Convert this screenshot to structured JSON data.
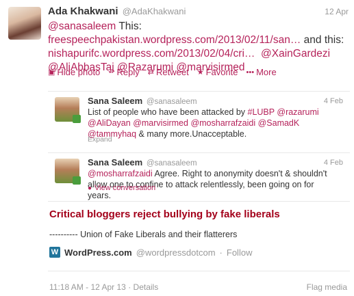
{
  "tweet": {
    "author_name": "Ada Khakwani",
    "author_handle": "@AdaKhakwani",
    "date": "12 Apr",
    "mention_lead": "@sanasaleem",
    "text_this": " This:",
    "link1": "freespeechpakistan.wordpress.com/2013/02/11/san…",
    "text_and": " and this:",
    "link2": "nishapurifc.wordpress.com/2013/02/04/cri…",
    "mention2": "@XainGardezi",
    "mention3": "@AliAbbasTaj",
    "mention4": "@Razarumi",
    "mention5": "@marvisirmed"
  },
  "actions": {
    "hide_photo": "Hide photo",
    "reply": "Reply",
    "retweet": "Retweet",
    "favorite": "Favorite",
    "more": "More"
  },
  "quote1": {
    "name": "Sana Saleem",
    "handle": "@sanasaleem",
    "date": "4 Feb",
    "text_pre": "List of people who have been attacked by ",
    "hashtag": "#LUBP",
    "m1": "@razarumi",
    "m2": "@AliDayan",
    "m3": "@marvisirmed",
    "m4": "@mosharrafzaidi",
    "m5": "@SamadK",
    "m6": "@tammyhaq",
    "text_post": " & many more.Unacceptable.",
    "expand": "Expand"
  },
  "quote2": {
    "name": "Sana Saleem",
    "handle": "@sanasaleem",
    "date": "4 Feb",
    "mention": "@mosharrafzaidi",
    "text": " Agree. Right to anonymity doesn't & shouldn't allow one to confine to attack relentlessly, been going on for years.",
    "view_conversation": "View conversation"
  },
  "card": {
    "headline": "Critical bloggers reject bullying by fake liberals",
    "subline": "---------- Union of Fake Liberals and their flatterers",
    "site_name": "WordPress.com",
    "site_handle": "@wordpressdotcom",
    "separator": "·",
    "follow": "Follow"
  },
  "footer": {
    "timestamp": "11:18 AM - 12 Apr 13",
    "separator": "·",
    "details": "Details",
    "flag_media": "Flag media"
  },
  "colors": {
    "link": "#b5225a",
    "headline": "#a3001a",
    "muted": "#999999"
  }
}
